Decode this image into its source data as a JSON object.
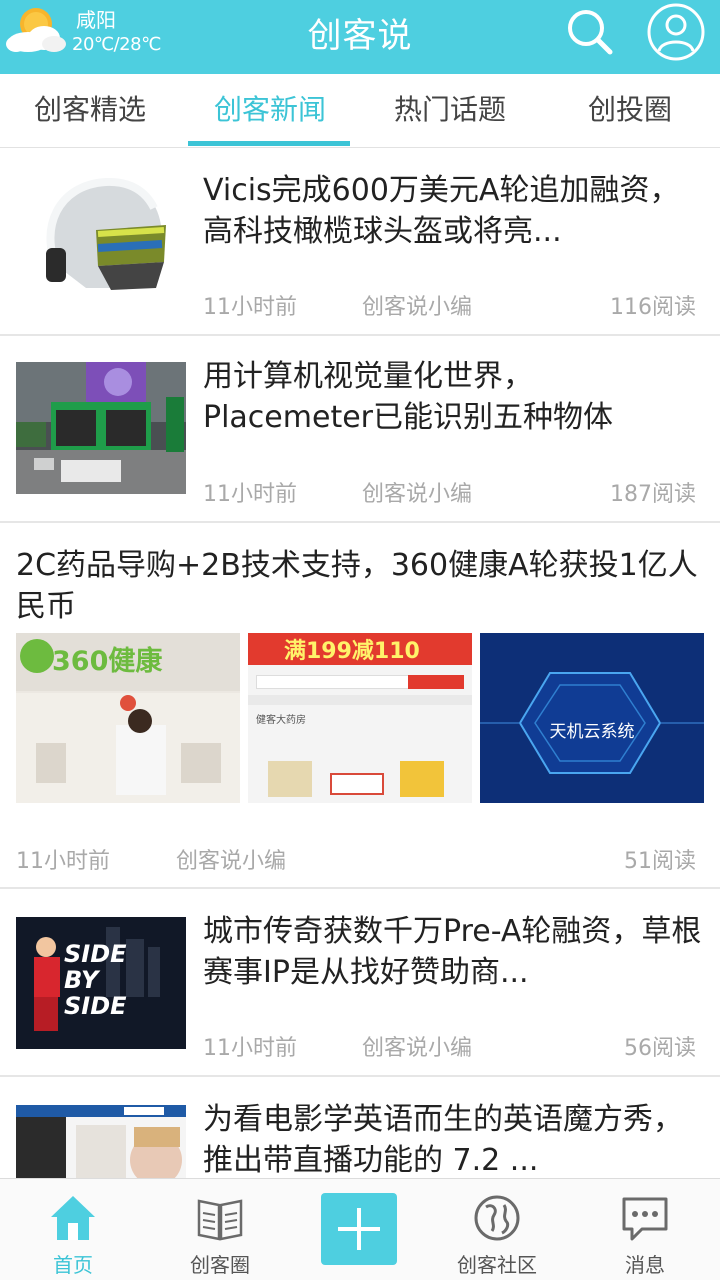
{
  "header": {
    "city": "咸阳",
    "temperature": "20℃/28℃",
    "title": "创客说"
  },
  "tabs": [
    {
      "label": "创客精选"
    },
    {
      "label": "创客新闻"
    },
    {
      "label": "热门话题"
    },
    {
      "label": "创投圈"
    }
  ],
  "active_tab": "创客新闻",
  "articles": [
    {
      "title": "Vicis完成600万美元A轮追加融资，高科技橄榄球头盔或将亮...",
      "time": "11小时前",
      "author": "创客说小编",
      "reads": "116阅读"
    },
    {
      "title": "用计算机视觉量化世界，Placemeter已能识别五种物体",
      "time": "11小时前",
      "author": "创客说小编",
      "reads": "187阅读"
    },
    {
      "title": "2C药品导购+2B技术支持，360健康A轮获投1亿人民币",
      "time": "11小时前",
      "author": "创客说小编",
      "reads": "51阅读",
      "image_texts": {
        "logo": "360健康",
        "banner": "满199减110",
        "system": "天机云系统",
        "store": "健客大药房"
      }
    },
    {
      "title": "城市传奇获数千万Pre-A轮融资，草根赛事IP是从找好赞助商...",
      "time": "11小时前",
      "author": "创客说小编",
      "reads": "56阅读",
      "image_texts": {
        "line1": "SIDE",
        "line2": "BY",
        "line3": "SIDE"
      }
    },
    {
      "title": "为看电影学英语而生的英语魔方秀，推出带直播功能的 7.2 ..."
    }
  ],
  "bottom_nav": [
    {
      "label": "首页",
      "icon": "home-icon"
    },
    {
      "label": "创客圈",
      "icon": "book-icon"
    },
    {
      "label": "",
      "icon": "plus-icon"
    },
    {
      "label": "创客社区",
      "icon": "globe-icon"
    },
    {
      "label": "消息",
      "icon": "message-icon"
    }
  ],
  "colors": {
    "accent": "#4ecfe0",
    "active_text": "#3cc4d6",
    "meta": "#a9a9a9"
  }
}
